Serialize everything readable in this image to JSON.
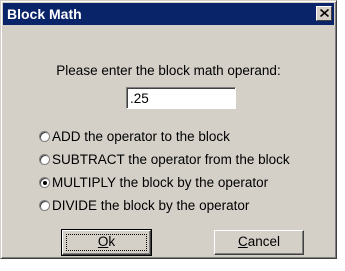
{
  "window": {
    "title": "Block Math",
    "close_symbol": "✕"
  },
  "prompt": "Please enter the block math operand:",
  "operand": {
    "value": ".25"
  },
  "options": [
    {
      "label": "ADD the operator to the block",
      "checked": false
    },
    {
      "label": "SUBTRACT the operator from the block",
      "checked": false
    },
    {
      "label": "MULTIPLY the block by the operator",
      "checked": true
    },
    {
      "label": "DIVIDE the block by the operator",
      "checked": false
    }
  ],
  "buttons": {
    "ok": {
      "mnemonic": "O",
      "rest": "k"
    },
    "cancel": {
      "mnemonic": "C",
      "rest": "ancel"
    }
  },
  "colors": {
    "titlebar": "#0a246a",
    "face": "#d4d0c8"
  }
}
